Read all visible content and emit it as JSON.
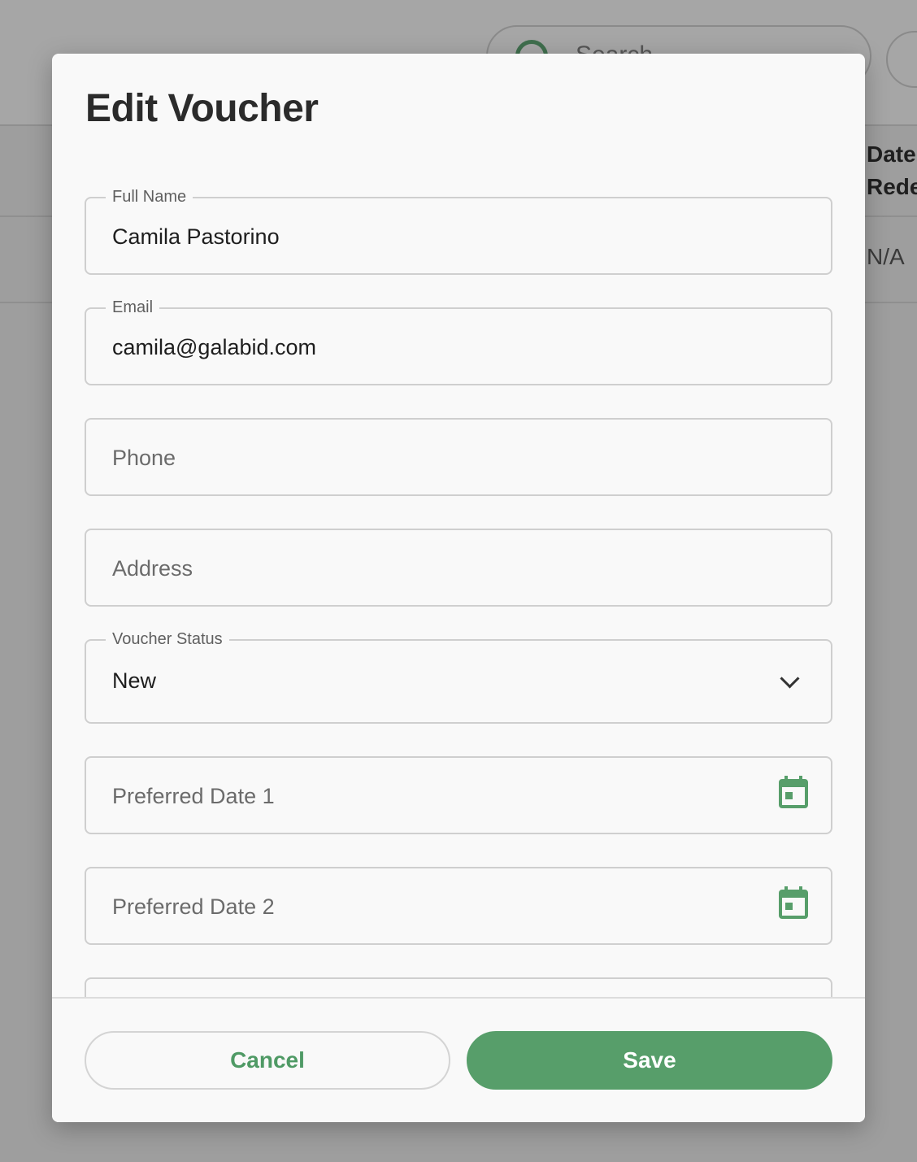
{
  "background": {
    "search_placeholder": "Search",
    "table_header": "Date Redeemed",
    "table_cell": "N/A"
  },
  "modal": {
    "title": "Edit Voucher",
    "fields": {
      "full_name": {
        "label": "Full Name",
        "value": "Camila Pastorino"
      },
      "email": {
        "label": "Email",
        "value": "camila@galabid.com"
      },
      "phone": {
        "placeholder": "Phone"
      },
      "address": {
        "placeholder": "Address"
      },
      "voucher_status": {
        "label": "Voucher Status",
        "value": "New"
      },
      "preferred_date_1": {
        "placeholder": "Preferred Date 1"
      },
      "preferred_date_2": {
        "placeholder": "Preferred Date 2"
      }
    },
    "footer": {
      "cancel_label": "Cancel",
      "save_label": "Save"
    }
  },
  "colors": {
    "accent": "#579e6a",
    "calendar_icon": "#579e6a"
  },
  "icons": [
    "search-icon",
    "chevron-down-icon",
    "calendar-icon"
  ]
}
